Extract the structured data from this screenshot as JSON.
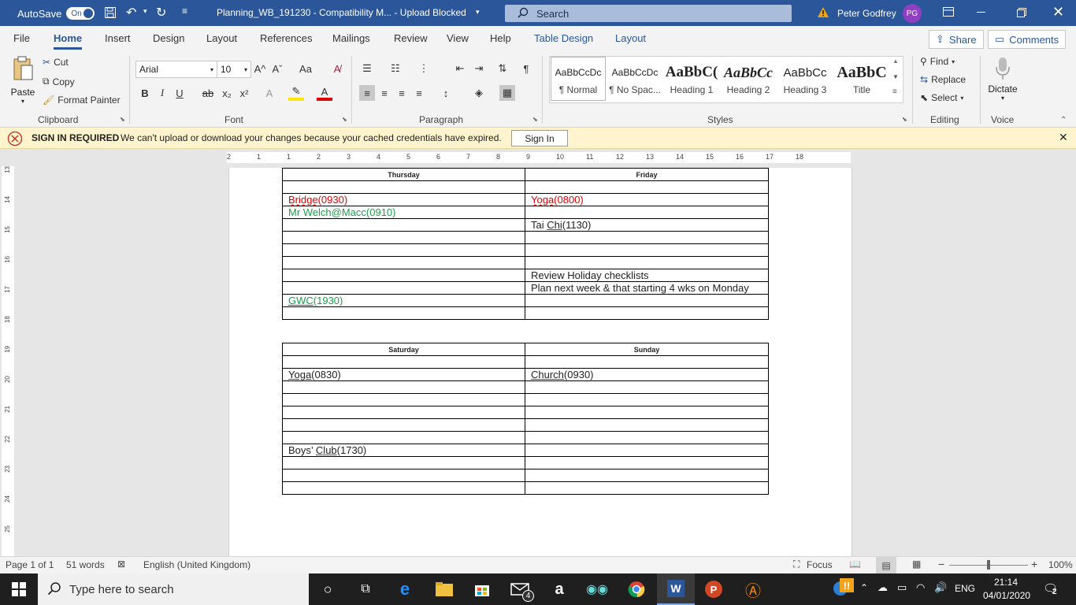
{
  "titlebar": {
    "autosave_label": "AutoSave",
    "autosave_state": "On",
    "doc_title": "Planning_WB_191230  -  Compatibility M...  -  Upload Blocked",
    "search_placeholder": "Search",
    "user_name": "Peter Godfrey",
    "user_initials": "PG"
  },
  "menu": {
    "items": [
      "File",
      "Home",
      "Insert",
      "Design",
      "Layout",
      "References",
      "Mailings",
      "Review",
      "View",
      "Help",
      "Table Design",
      "Layout"
    ],
    "active": "Home",
    "share_label": "Share",
    "comments_label": "Comments"
  },
  "ribbon": {
    "clipboard": {
      "paste": "Paste",
      "cut": "Cut",
      "copy": "Copy",
      "format_painter": "Format Painter",
      "label": "Clipboard"
    },
    "font": {
      "name": "Arial",
      "size": "10",
      "label": "Font",
      "bold": "B",
      "italic": "I",
      "underline": "U",
      "strike": "ab",
      "sub": "x₂",
      "sup": "x²",
      "grow": "A^",
      "shrink": "Aˇ",
      "case": "Aa"
    },
    "paragraph": {
      "label": "Paragraph"
    },
    "styles": {
      "label": "Styles",
      "items": [
        {
          "preview": "AaBbCcDc",
          "name": "¶ Normal"
        },
        {
          "preview": "AaBbCcDc",
          "name": "¶ No Spac..."
        },
        {
          "preview": "AaBbC(",
          "name": "Heading 1"
        },
        {
          "preview": "AaBbCc",
          "name": "Heading 2"
        },
        {
          "preview": "AaBbCc",
          "name": "Heading 3"
        },
        {
          "preview": "AaBbC",
          "name": "Title"
        }
      ]
    },
    "editing": {
      "find": "Find",
      "replace": "Replace",
      "select": "Select",
      "label": "Editing"
    },
    "voice": {
      "dictate": "Dictate",
      "label": "Voice"
    }
  },
  "infobar": {
    "title": "SIGN IN REQUIRED",
    "message": "We can't upload or download your changes because your cached credentials have expired.",
    "button": "Sign In"
  },
  "ruler": {
    "h_ticks": [
      "2",
      "1",
      "1",
      "2",
      "3",
      "4",
      "5",
      "6",
      "7",
      "8",
      "9",
      "10",
      "11",
      "12",
      "13",
      "14",
      "15",
      "16",
      "17",
      "18"
    ],
    "v_ticks": [
      "13",
      "14",
      "15",
      "16",
      "17",
      "18",
      "19",
      "20",
      "21",
      "22",
      "23",
      "24",
      "25"
    ]
  },
  "document": {
    "table1": {
      "headers": [
        "Thursday",
        "Friday"
      ],
      "rows": [
        [
          "",
          ""
        ],
        [
          "Bridge(0930)",
          "Yoga(0800)"
        ],
        [
          "Mr Welch@Macc(0910)",
          ""
        ],
        [
          "",
          "Tai Chi(1130)"
        ],
        [
          "",
          ""
        ],
        [
          "",
          ""
        ],
        [
          "",
          ""
        ],
        [
          "",
          "Review Holiday checklists"
        ],
        [
          "",
          "Plan next week & that starting 4 wks on Monday"
        ],
        [
          "GWC(1930)",
          ""
        ],
        [
          "",
          ""
        ]
      ]
    },
    "table2": {
      "headers": [
        "Saturday",
        "Sunday"
      ],
      "rows": [
        [
          "",
          ""
        ],
        [
          "Yoga(0830)",
          "Church(0930)"
        ],
        [
          "",
          ""
        ],
        [
          "",
          ""
        ],
        [
          "",
          ""
        ],
        [
          "",
          ""
        ],
        [
          "",
          ""
        ],
        [
          "Boys’ Club(1730)",
          ""
        ],
        [
          "",
          ""
        ],
        [
          "",
          ""
        ],
        [
          "",
          ""
        ]
      ]
    }
  },
  "statusbar": {
    "page": "Page 1 of 1",
    "words": "51 words",
    "language": "English (United Kingdom)",
    "focus": "Focus",
    "zoom": "100%",
    "zoom_level": 0.5
  },
  "taskbar": {
    "search_placeholder": "Type here to search",
    "lang": "ENG",
    "time": "21:14",
    "date": "04/01/2020",
    "notifications": "2",
    "mail_badge": "4"
  },
  "colors": {
    "accent": "#2b579a",
    "infobar": "#fff4ce",
    "red_text": "#e00000",
    "green_text": "#1c9f4a"
  }
}
